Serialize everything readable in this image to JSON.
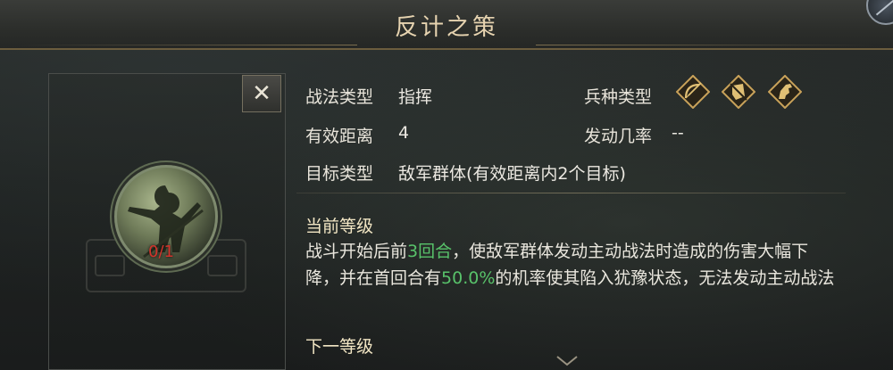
{
  "window": {
    "title": "反计之策"
  },
  "close_button": {
    "label": "✕"
  },
  "portrait": {
    "level": "0/1"
  },
  "attributes": {
    "tactic_type_label": "战法类型",
    "tactic_type_value": "指挥",
    "range_label": "有效距离",
    "range_value": "4",
    "target_label": "目标类型",
    "target_value": "敌军群体(有效距离内2个目标)",
    "troop_type_label": "兵种类型",
    "trigger_rate_label": "发动几率",
    "trigger_rate_value": "--",
    "troop_icons": [
      "bow-archer-icon",
      "shield-infantry-icon",
      "horse-cavalry-icon"
    ]
  },
  "current_level": {
    "title": "当前等级",
    "desc_part1": "战斗开始后前",
    "desc_hl1": "3回合",
    "desc_part2": "，使敌军群体发动主动战法时造成的伤害大幅下降，并在首回合有",
    "desc_hl2": "50.0%",
    "desc_part3": "的机率使其陷入犹豫状态，无法发动主动战法"
  },
  "next_level": {
    "title": "下一等级"
  },
  "colors": {
    "highlight_green": "#58c26a",
    "level_red": "#d2332b",
    "title_gold": "#e6d3b0",
    "icon_gold": "#c9a25a"
  }
}
